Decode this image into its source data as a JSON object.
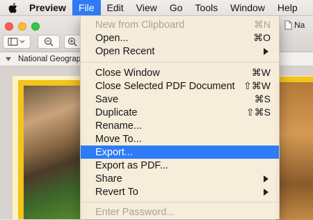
{
  "menubar": {
    "app": "Preview",
    "items": [
      "File",
      "Edit",
      "View",
      "Go",
      "Tools",
      "Window",
      "Help"
    ]
  },
  "window": {
    "doc_tab": "Na",
    "sidebar_title": "National Geograp"
  },
  "file_menu": {
    "items": [
      {
        "label": "New from Clipboard",
        "shortcut": "⌘N",
        "disabled": true
      },
      {
        "label": "Open...",
        "shortcut": "⌘O"
      },
      {
        "label": "Open Recent",
        "submenu": true
      },
      {
        "label": "Close Window",
        "shortcut": "⌘W"
      },
      {
        "label": "Close Selected PDF Document",
        "shortcut": "⇧⌘W"
      },
      {
        "label": "Save",
        "shortcut": "⌘S"
      },
      {
        "label": "Duplicate",
        "shortcut": "⇧⌘S"
      },
      {
        "label": "Rename..."
      },
      {
        "label": "Move To..."
      },
      {
        "label": "Export...",
        "highlighted": true
      },
      {
        "label": "Export as PDF..."
      },
      {
        "label": "Share",
        "submenu": true
      },
      {
        "label": "Revert To",
        "submenu": true
      },
      {
        "label": "Enter Password...",
        "disabled": true
      }
    ]
  },
  "colors": {
    "highlight": "#2e7bf6",
    "menu_bg": "#f6ecdc"
  }
}
